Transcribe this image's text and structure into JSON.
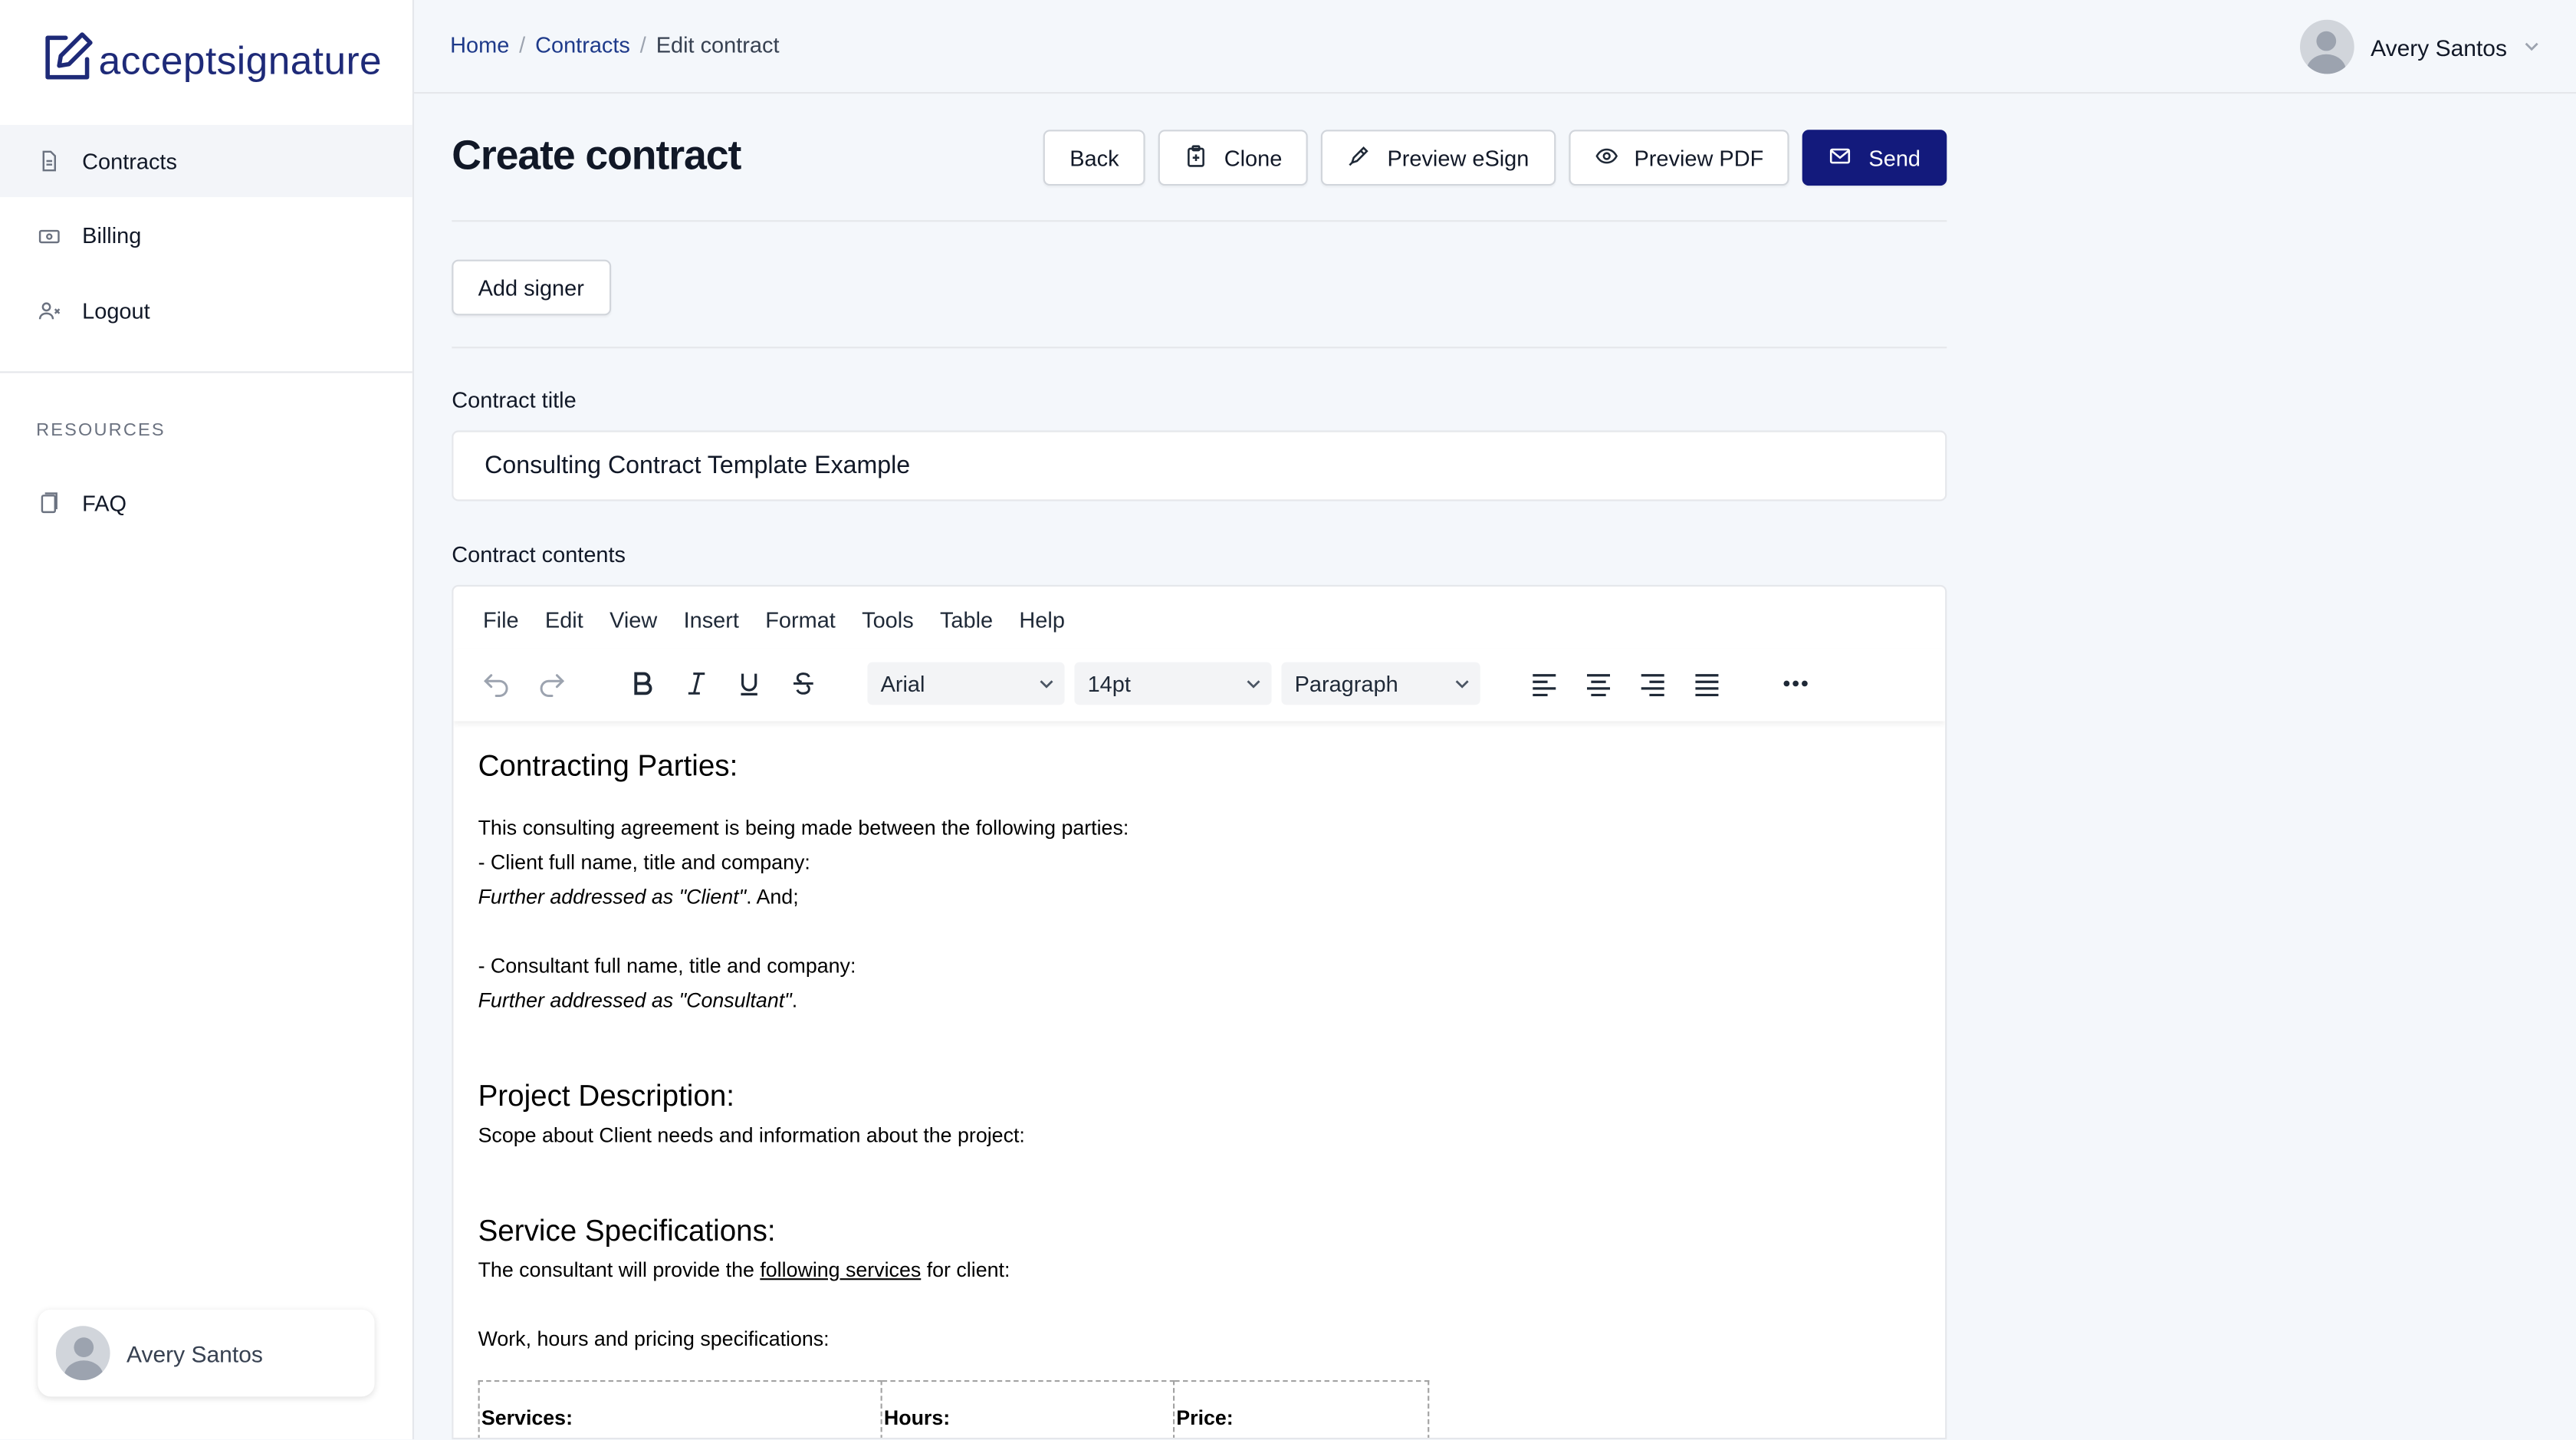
{
  "brand": {
    "name": "acceptsignature",
    "primary_color": "#131a7c",
    "logo_icon": "pen-square-icon"
  },
  "sidebar": {
    "items": [
      {
        "label": "Contracts",
        "icon": "document-icon",
        "active": true
      },
      {
        "label": "Billing",
        "icon": "cash-icon",
        "active": false
      },
      {
        "label": "Logout",
        "icon": "user-remove-icon",
        "active": false
      }
    ],
    "resources_heading": "RESOURCES",
    "resources": [
      {
        "label": "FAQ",
        "icon": "copy-icon"
      }
    ],
    "user_name": "Avery Santos"
  },
  "header": {
    "breadcrumb": [
      "Home",
      "Contracts",
      "Edit contract"
    ],
    "user_name": "Avery Santos"
  },
  "page": {
    "title": "Create contract",
    "actions": {
      "back": "Back",
      "clone": "Clone",
      "preview_esign": "Preview eSign",
      "preview_pdf": "Preview PDF",
      "send": "Send"
    },
    "add_signer": "Add signer",
    "contract_title_label": "Contract title",
    "contract_title_value": "Consulting Contract Template Example",
    "contract_contents_label": "Contract contents"
  },
  "editor": {
    "menu": [
      "File",
      "Edit",
      "View",
      "Insert",
      "Format",
      "Tools",
      "Table",
      "Help"
    ],
    "font_family": "Arial",
    "font_size": "14pt",
    "block_format": "Paragraph",
    "document": {
      "h1": "Contracting Parties:",
      "p1": "This consulting agreement is being made between the following parties:",
      "p2": "- Client full name, title and company:",
      "p3_italic": "Further addressed as \"Client\"",
      "p3_rest": ". And;",
      "p4": "- Consultant full name, title and company:",
      "p5_italic": "Further addressed as \"Consultant\"",
      "p5_rest": ".",
      "h2": "Project Description:",
      "p6": "Scope about Client needs and information about the project:",
      "h3": "Service Specifications:",
      "p7_a": "The consultant will provide the ",
      "p7_link": "following services",
      "p7_b": " for client:",
      "p8": "Work, hours and pricing specifications:",
      "table_headers": [
        "Services:",
        "Hours:",
        "Price:"
      ]
    }
  }
}
